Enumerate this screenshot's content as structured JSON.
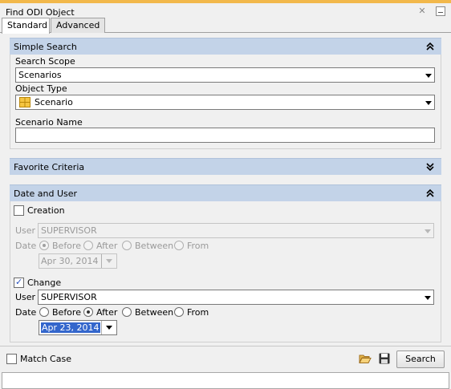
{
  "window": {
    "title": "Find ODI Object"
  },
  "tabs": [
    {
      "label": "Standard",
      "active": true
    },
    {
      "label": "Advanced",
      "active": false
    }
  ],
  "simple_search": {
    "header": "Simple Search",
    "search_scope_label": "Search Scope",
    "search_scope_value": "Scenarios",
    "object_type_label": "Object Type",
    "object_type_value": "Scenario",
    "object_type_icon": "scenario-grid-icon",
    "name_label": "Scenario Name",
    "name_value": ""
  },
  "favorite_criteria": {
    "header": "Favorite Criteria"
  },
  "date_and_user": {
    "header": "Date and User",
    "creation": {
      "label": "Creation",
      "checked": false,
      "user_label": "User",
      "user_value": "SUPERVISOR",
      "date_label": "Date",
      "radios": [
        "Before",
        "After",
        "Between",
        "From"
      ],
      "selected": "Before",
      "date_value": "Apr 30, 2014"
    },
    "change": {
      "label": "Change",
      "checked": true,
      "user_label": "User",
      "user_value": "SUPERVISOR",
      "date_label": "Date",
      "radios": [
        "Before",
        "After",
        "Between",
        "From"
      ],
      "selected": "After",
      "date_value": "Apr 23, 2014"
    }
  },
  "footer": {
    "match_case_label": "Match Case",
    "search_button": "Search",
    "open_icon": "folder-open-icon",
    "save_icon": "save-disk-icon"
  },
  "colors": {
    "section_header": "#c3d3e8",
    "accent_top": "#f2b84b",
    "selection": "#3366cc"
  }
}
